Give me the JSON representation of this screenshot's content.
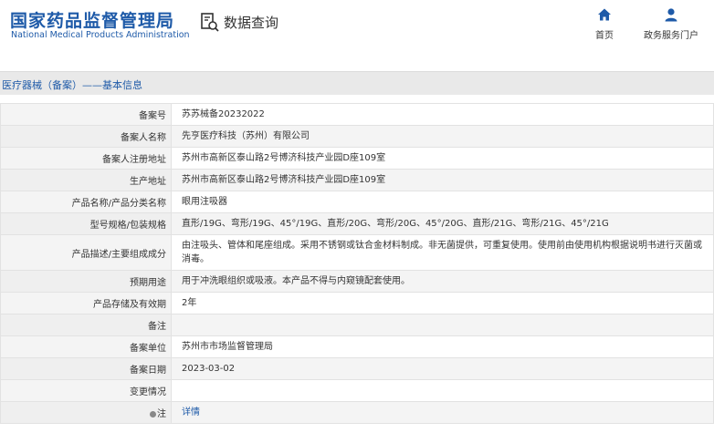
{
  "header": {
    "logo_cn": "国家药品监督管理局",
    "logo_en": "National Medical Products Administration",
    "query_label": "数据查询",
    "nav": [
      {
        "label": "首页",
        "icon": "home-icon"
      },
      {
        "label": "政务服务门户",
        "icon": "user-icon"
      }
    ]
  },
  "breadcrumb": "医疗器械（备案）——基本信息",
  "colors": {
    "brand": "#1e5aa8",
    "label_bg": "#f4f4f4",
    "border": "#e2e2e2"
  },
  "rows": [
    {
      "label": "备案号",
      "value": "苏苏械备20232022"
    },
    {
      "label": "备案人名称",
      "value": "先亨医疗科技（苏州）有限公司"
    },
    {
      "label": "备案人注册地址",
      "value": "苏州市高新区泰山路2号博济科技产业园D座109室"
    },
    {
      "label": "生产地址",
      "value": "苏州市高新区泰山路2号博济科技产业园D座109室"
    },
    {
      "label": "产品名称/产品分类名称",
      "value": "眼用注吸器"
    },
    {
      "label": "型号规格/包装规格",
      "value": "直形/19G、弯形/19G、45°/19G、直形/20G、弯形/20G、45°/20G、直形/21G、弯形/21G、45°/21G"
    },
    {
      "label": "产品描述/主要组成成分",
      "value": "由注吸头、管体和尾座组成。采用不锈钢或钛合金材料制成。非无菌提供，可重复使用。使用前由使用机构根据说明书进行灭菌或消毒。"
    },
    {
      "label": "预期用途",
      "value": "用于冲洗眼组织或吸液。本产品不得与内窥镜配套使用。"
    },
    {
      "label": "产品存储及有效期",
      "value": "2年"
    },
    {
      "label": "备注",
      "value": ""
    },
    {
      "label": "备案单位",
      "value": "苏州市市场监督管理局"
    },
    {
      "label": "备案日期",
      "value": "2023-03-02"
    },
    {
      "label": "变更情况",
      "value": ""
    },
    {
      "label": "注",
      "value": "详情"
    }
  ]
}
